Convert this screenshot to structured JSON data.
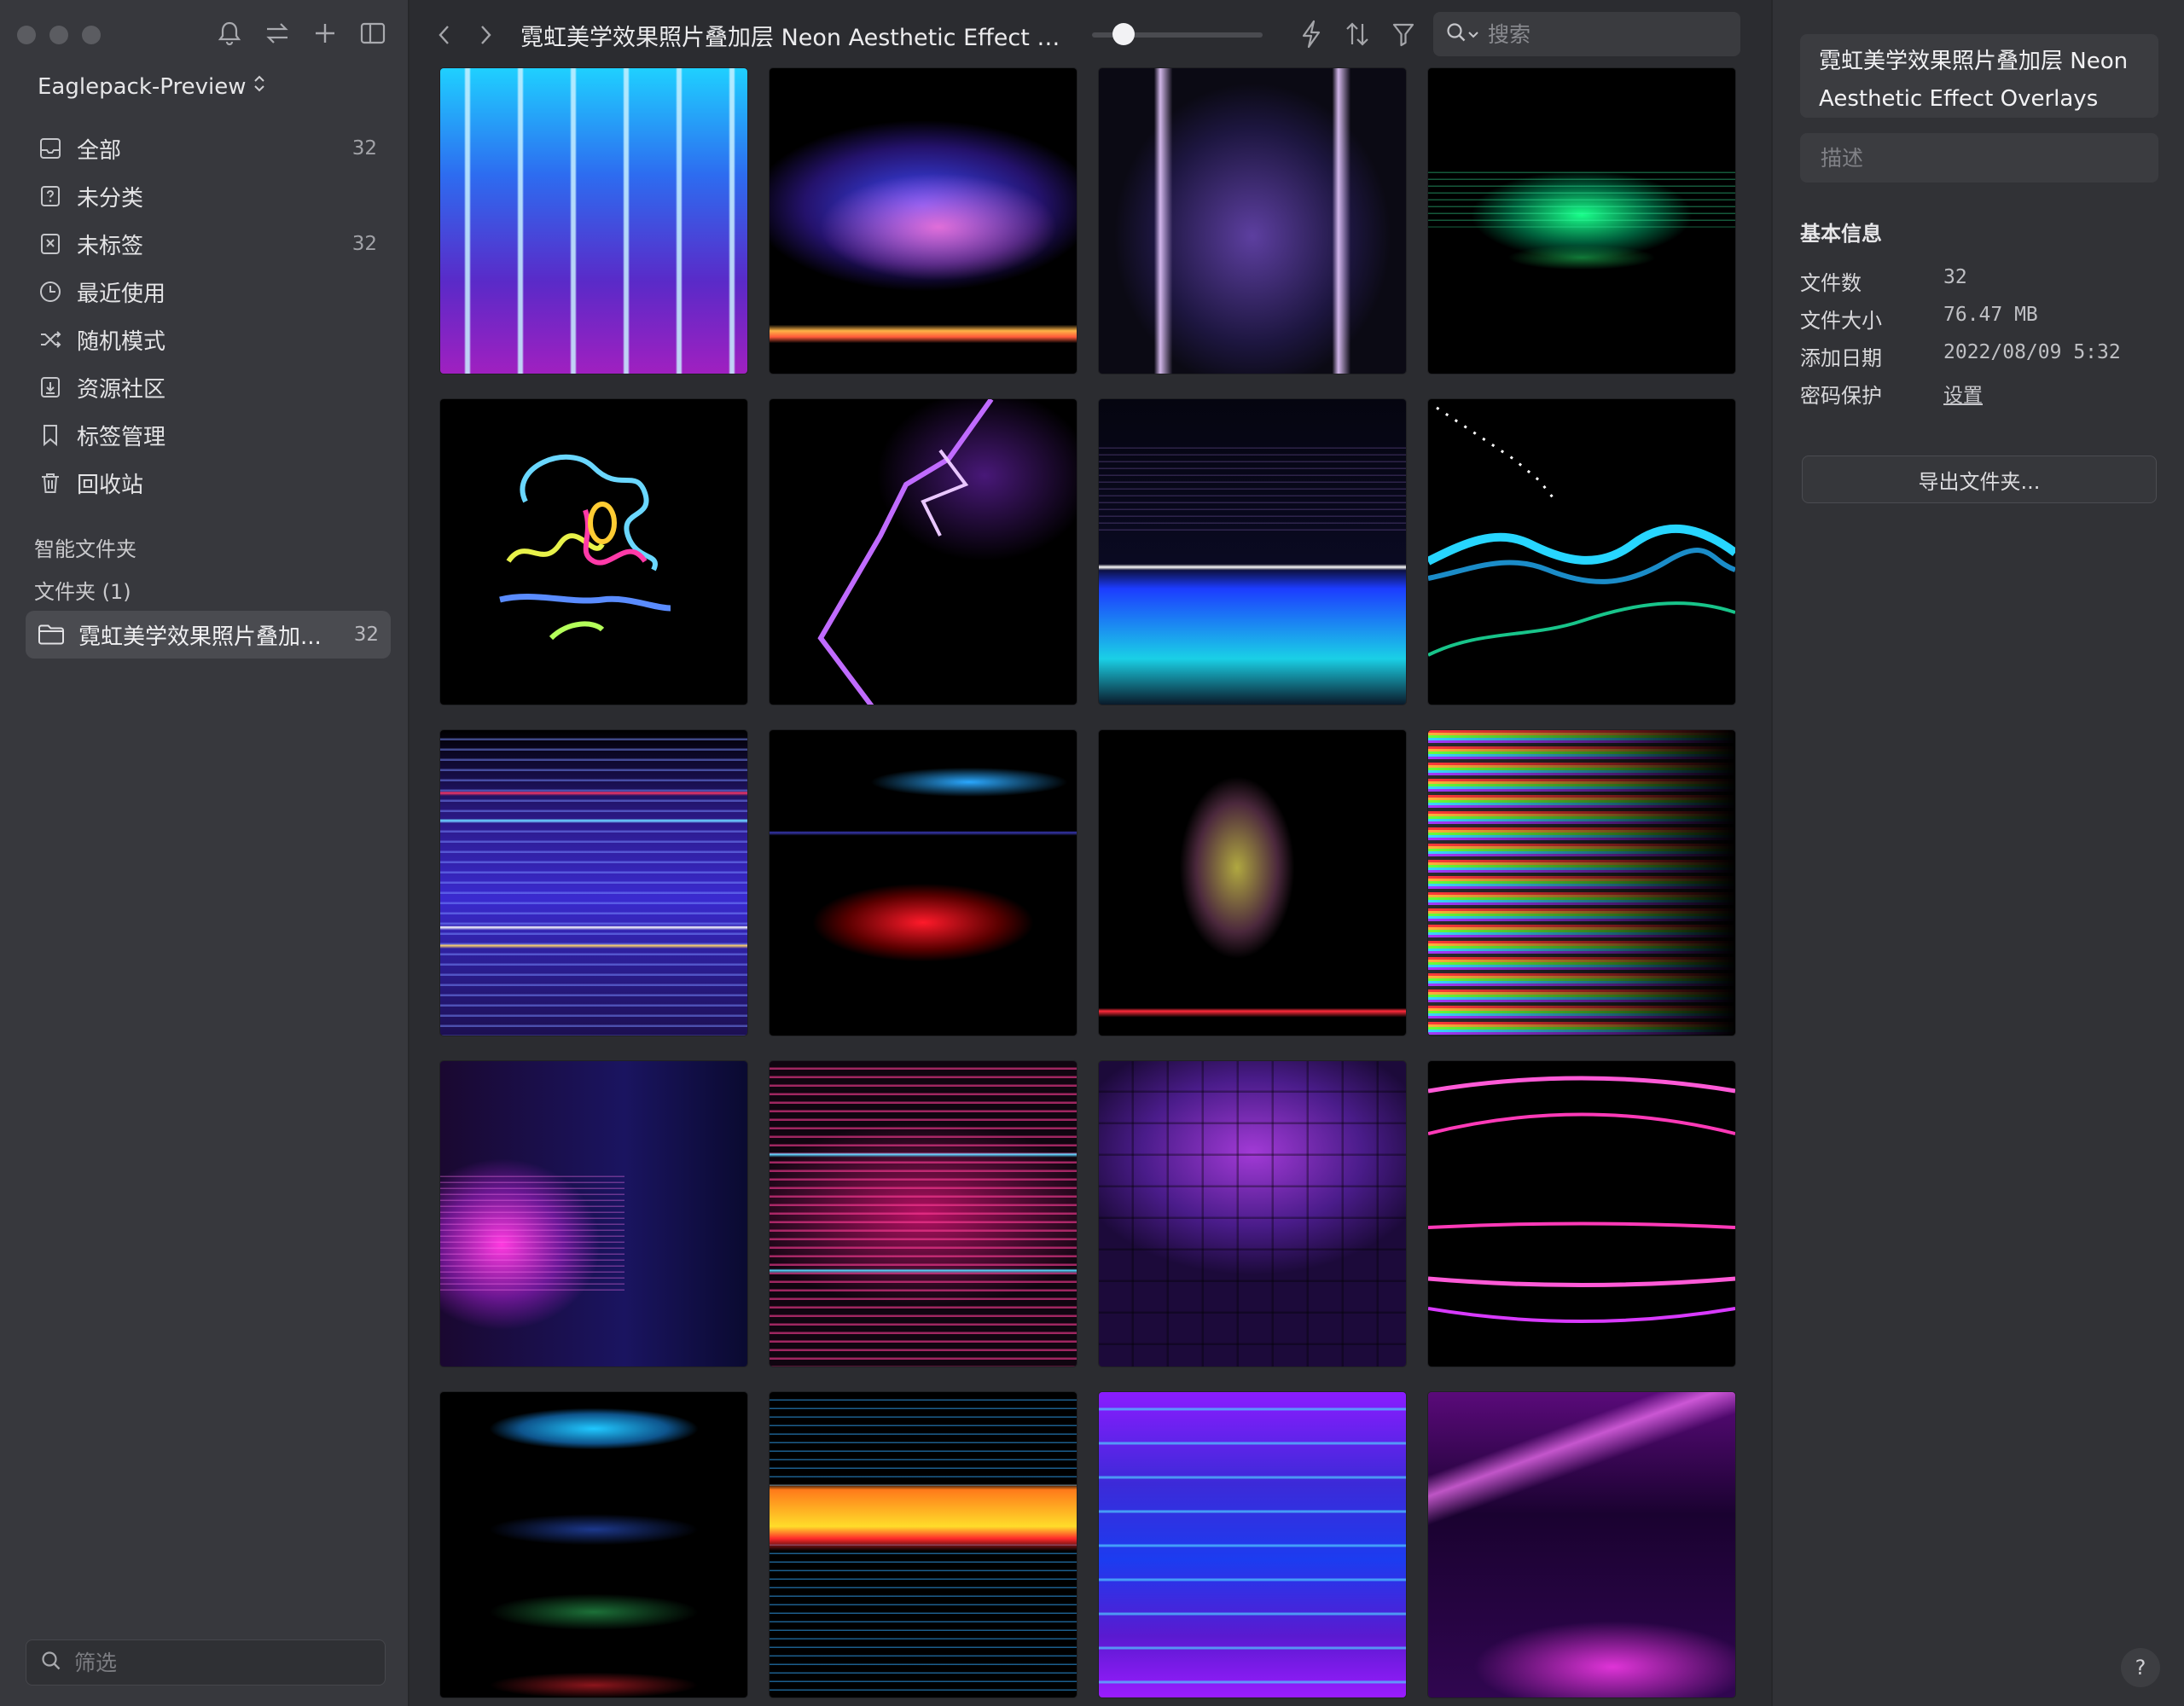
{
  "sidebar": {
    "library_name": "Eaglepack-Preview",
    "nav": [
      {
        "label": "全部",
        "count": "32"
      },
      {
        "label": "未分类",
        "count": ""
      },
      {
        "label": "未标签",
        "count": "32"
      },
      {
        "label": "最近使用",
        "count": ""
      },
      {
        "label": "随机模式",
        "count": ""
      },
      {
        "label": "资源社区",
        "count": ""
      },
      {
        "label": "标签管理",
        "count": ""
      },
      {
        "label": "回收站",
        "count": ""
      }
    ],
    "smart_folders_title": "智能文件夹",
    "folders_title": "文件夹 (1)",
    "active_folder": {
      "label": "霓虹美学效果照片叠加...",
      "count": "32"
    },
    "filter_placeholder": "筛选"
  },
  "toolbar": {
    "title": "霓虹美学效果照片叠加层 Neon Aesthetic Effect O...",
    "search_placeholder": "搜索",
    "zoom_level": 0.14
  },
  "inspector": {
    "name": "霓虹美学效果照片叠加层 Neon Aesthetic Effect Overlays",
    "description_placeholder": "描述",
    "basic_info_title": "基本信息",
    "rows": [
      {
        "key": "文件数",
        "value": "32"
      },
      {
        "key": "文件大小",
        "value": "76.47 MB"
      },
      {
        "key": "添加日期",
        "value": "2022/08/09 5:32"
      },
      {
        "key": "密码保护",
        "value": "设置"
      }
    ],
    "export_label": "导出文件夹...",
    "help_label": "?"
  },
  "thumbnails": [
    {
      "name": "neon-vertical-stripes"
    },
    {
      "name": "blue-pink-glow-orange-line"
    },
    {
      "name": "purple-neon-arch"
    },
    {
      "name": "green-horizon-glow"
    },
    {
      "name": "neon-scribble-shapes"
    },
    {
      "name": "purple-lightning"
    },
    {
      "name": "blue-cyan-horizon-lines"
    },
    {
      "name": "cyan-waves-dots"
    },
    {
      "name": "multicolor-light-streaks"
    },
    {
      "name": "blue-red-blur-bands"
    },
    {
      "name": "yellow-pink-blur-tower"
    },
    {
      "name": "rainbow-streaks"
    },
    {
      "name": "magenta-motion-blur"
    },
    {
      "name": "pink-stripes-cyan-lines"
    },
    {
      "name": "purple-tiled-floor"
    },
    {
      "name": "pink-neon-arcs"
    },
    {
      "name": "cyan-green-blur-blocks"
    },
    {
      "name": "orange-yellow-streak"
    },
    {
      "name": "blue-purple-streaks"
    },
    {
      "name": "magenta-light-sweep"
    }
  ]
}
